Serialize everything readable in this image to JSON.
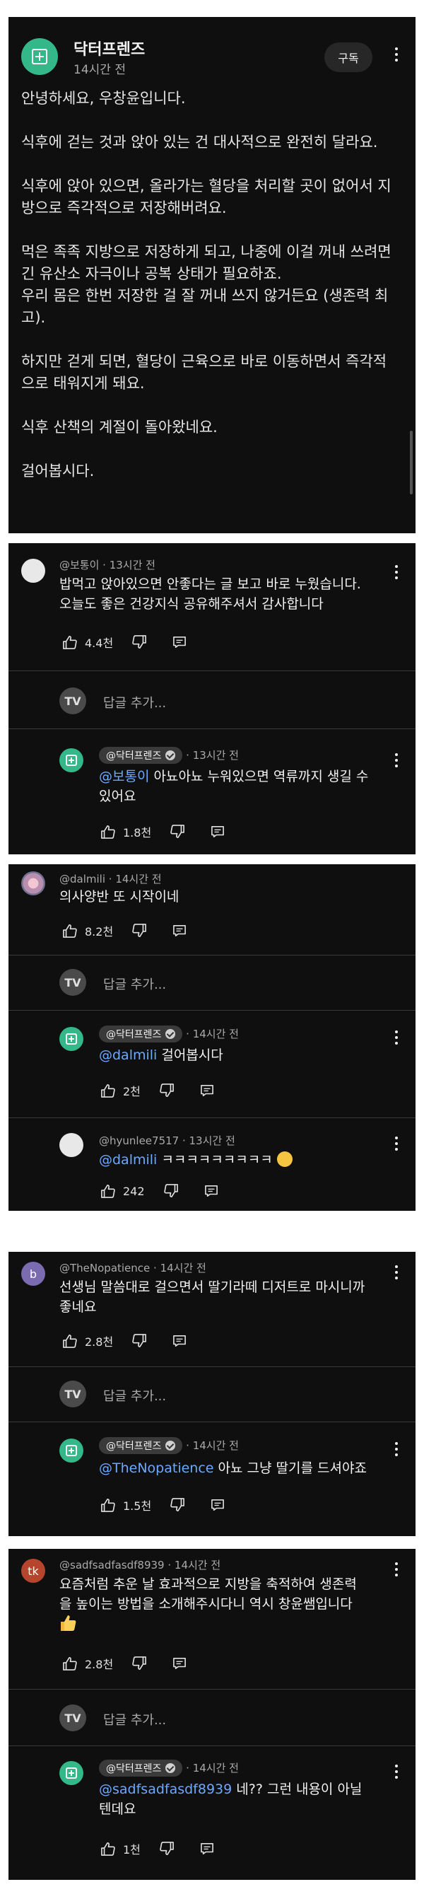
{
  "post": {
    "channel": "닥터프렌즈",
    "time": "14시간 전",
    "subscribe": "구독",
    "paragraphs": [
      "안녕하세요, 우창윤입니다.",
      "식후에 걷는 것과 앉아 있는 건 대사적으로 완전히 달라요.",
      "식후에 앉아 있으면, 올라가는 혈당을 처리할 곳이 없어서 지방으로 즉각적으로 저장해버려요.",
      "먹은 족족 지방으로 저장하게 되고, 나중에 이걸 꺼내 쓰려면 긴 유산소 자극이나 공복 상태가 필요하죠.\n우리 몸은 한번 저장한 걸 잘 꺼내 쓰지 않거든요 (생존력 최고).",
      "하지만 걷게 되면, 혈당이 근육으로 바로 이동하면서 즉각적으로 태워지게 돼요.",
      "식후 산책의 계절이 돌아왔네요.",
      "걸어봅시다."
    ]
  },
  "reply_placeholder": "답글 추가...",
  "tv_initials": "TV",
  "comments": [
    {
      "handle": "@보통이",
      "time": "13시간 전",
      "lines": [
        "밥먹고 앉아있으면 안좋다는 글 보고 바로 누웠습니다.",
        "오늘도 좋은 건강지식 공유해주셔서 감사합니다"
      ],
      "likes": "4.4천",
      "reply": {
        "badge": "@닥터프렌즈",
        "time": "13시간 전",
        "mention": "@보통이",
        "text_line1": " 아뇨아뇨 누워있으면 역류까지 생길 수",
        "text_line2": "있어요",
        "likes": "1.8천"
      }
    },
    {
      "handle": "@dalmili",
      "time": "14시간 전",
      "lines": [
        "의사양반 또 시작이네"
      ],
      "likes": "8.2천",
      "reply": {
        "badge": "@닥터프렌즈",
        "time": "14시간 전",
        "mention": "@dalmili",
        "text_line1": " 걸어봅시다",
        "likes": "2천"
      },
      "reply2": {
        "handle": "@hyunlee7517",
        "time": "13시간 전",
        "mention": "@dalmili",
        "text": " ㅋㅋㅋㅋㅋㅋㅋㅋㅋ",
        "likes": "242"
      }
    },
    {
      "handle": "@TheNopatience",
      "time": "14시간 전",
      "avatar_letter": "b",
      "lines": [
        "선생님 말씀대로 걸으면서 딸기라떼 디저트로 마시니까",
        "좋네요"
      ],
      "likes": "2.8천",
      "reply": {
        "badge": "@닥터프렌즈",
        "time": "14시간 전",
        "mention": "@TheNopatience",
        "text_line1": " 아뇨 그냥 딸기를 드셔야죠",
        "likes": "1.5천"
      }
    },
    {
      "handle": "@sadfsadfasdf8939",
      "time": "14시간 전",
      "avatar_letter": "tk",
      "lines": [
        "요즘처럼 추운 날 효과적으로 지방을 축적하여 생존력",
        "을 높이는 방법을 소개해주시다니 역시 창윤쌤입니다"
      ],
      "likes": "2.8천",
      "reply": {
        "badge": "@닥터프렌즈",
        "time": "14시간 전",
        "mention": "@sadfsadfasdf8939",
        "text_line1": " 네?? 그런 내용이 아닐",
        "text_line2": "텐데요",
        "likes": "1천"
      }
    }
  ],
  "colors": {
    "card_bg": "#0f0f0f",
    "channel_avatar": "#34b88a",
    "mention": "#6fa8ff",
    "text_secondary": "#aaaaaa"
  }
}
